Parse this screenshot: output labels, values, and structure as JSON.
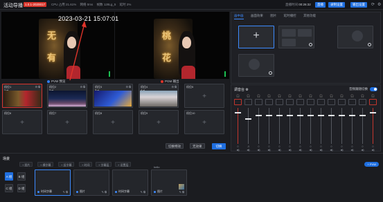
{
  "topbar": {
    "title": "活动导播",
    "badge": "1.0.1-2020017",
    "stats": [
      "CPU 占用 21.61%",
      "网络 0ms",
      "帧数 128Lg_5",
      "延时 2%"
    ],
    "live_label": "直播时间",
    "live_time": "00:26:32",
    "btn_live": "直播",
    "btn_record": "录制设置",
    "btn_output": "输出设置"
  },
  "monitor": {
    "timestamp": "2023-03-21 15:07:01",
    "pvw_label": "PVW 预览",
    "pgm_label": "PGM 输出",
    "poster_chars": [
      "无",
      "桃",
      "有",
      "花"
    ]
  },
  "sources": [
    {
      "name": "机位1",
      "num": "1.rt",
      "active": true
    },
    {
      "name": "机位2",
      "num": "2.rt"
    },
    {
      "name": "机位3",
      "num": "3.rt"
    },
    {
      "name": "机位4",
      "num": "4.rt"
    },
    {
      "name": "机位5",
      "empty": true
    },
    {
      "name": "机位6",
      "empty": true
    },
    {
      "name": "机位7",
      "empty": true
    },
    {
      "name": "机位8",
      "empty": true
    },
    {
      "name": "机位9",
      "empty": true
    },
    {
      "name": "机位10",
      "empty": true
    }
  ],
  "grid_controls": {
    "transition": "切换特效",
    "duration": "无效果",
    "cut": "切换"
  },
  "right_tabs": [
    "画中画",
    "画面效果",
    "图片",
    "延时播控",
    "其他功能"
  ],
  "mixer": {
    "title": "调音台",
    "follow_label": "音频跟随切换",
    "strips": [
      {
        "label": "主",
        "value": "0",
        "red": true,
        "level": 0.88
      },
      {
        "label": "1",
        "value": "-5",
        "level": 0.72
      },
      {
        "label": "2",
        "value": "0",
        "level": 0.8
      },
      {
        "label": "3",
        "value": "0",
        "level": 0.8
      },
      {
        "label": "4",
        "value": "0",
        "level": 0.8
      },
      {
        "label": "5",
        "value": "0",
        "level": 0.8
      },
      {
        "label": "6",
        "value": "0",
        "level": 0.8
      },
      {
        "label": "7",
        "value": "0",
        "level": 0.8
      },
      {
        "label": "8",
        "value": "0",
        "level": 0.8
      },
      {
        "label": "9",
        "value": "0",
        "level": 0.8
      },
      {
        "label": "10",
        "value": "0",
        "level": 0.8
      },
      {
        "label": "11",
        "value": "0",
        "level": 0.8
      },
      {
        "label": "12",
        "value": "0",
        "level": 0.8
      },
      {
        "label": "PGM",
        "value": "0",
        "red": true,
        "level": 0.88
      }
    ]
  },
  "bottom": {
    "title": "场景",
    "chips": [
      "+ 图片",
      "+ 横字幕",
      "+ 竖字幕",
      "+ 时间",
      "+ 字幕层",
      "+ 设置层"
    ],
    "pgm_btn": "+ PVW",
    "ab": [
      "A 组",
      "B 组",
      "C 组",
      "D 组"
    ],
    "cards": [
      {
        "caption": "时间字幕",
        "active": true
      },
      {
        "caption": "图片"
      },
      {
        "caption": "时间字幕"
      },
      {
        "caption": "图片",
        "tag": "hello"
      }
    ]
  }
}
